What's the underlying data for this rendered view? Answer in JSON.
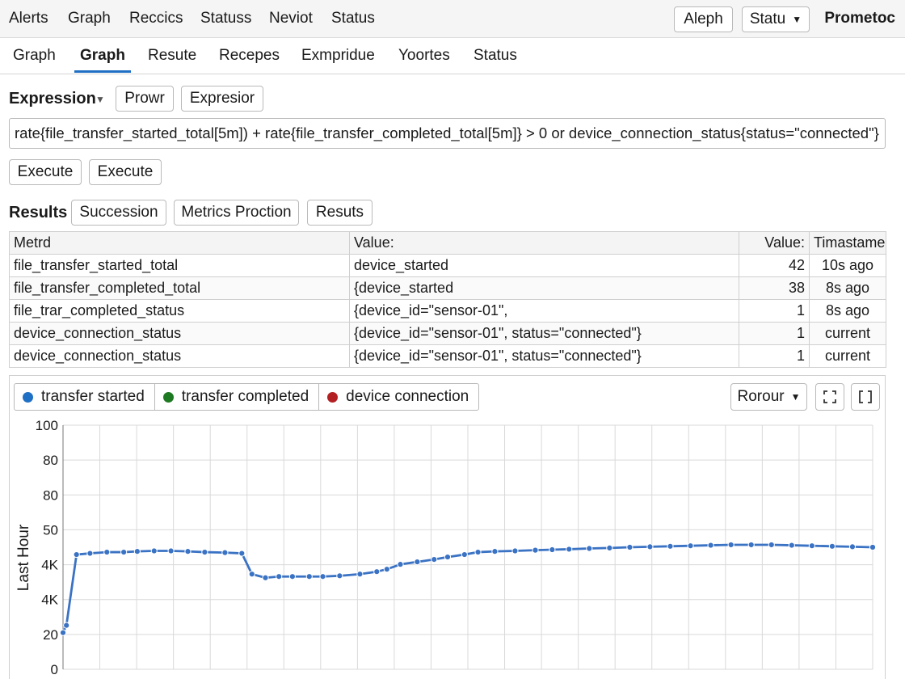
{
  "topnav": {
    "items": [
      "Alerts",
      "Graph",
      "Reccics",
      "Statuss",
      "Neviot",
      "Status"
    ],
    "aleph_button": "Aleph",
    "status_dropdown": "Statu",
    "brand": "Prometoc"
  },
  "tabs": [
    "Graph",
    "Graph",
    "Resute",
    "Recepes",
    "Exmpridue",
    "Yoortes",
    "Status"
  ],
  "expression": {
    "label": "Expression",
    "buttons": [
      "Prowr",
      "Expresior"
    ],
    "query": "rate{file_transfer_started_total[5m]) + rate{file_transfer_completed_total[5m]} > 0 or device_connection_status{status=\"connected\"}",
    "execute_buttons": [
      "Execute",
      "Execute"
    ]
  },
  "results": {
    "label": "Results",
    "buttons": [
      "Succession",
      "Metrics Proction",
      "Resuts"
    ],
    "columns": [
      "Metrd",
      "Value:",
      "Value:",
      "Timastame"
    ],
    "rows": [
      [
        "file_transfer_started_total",
        "device_started",
        "42",
        "10s ago"
      ],
      [
        "file_transfer_completed_total",
        "{device_started",
        "38",
        "8s ago"
      ],
      [
        "file_trar_completed_status",
        "{device_id=\"sensor-01\",",
        "1",
        "8s ago"
      ],
      [
        "device_connection_status",
        "{device_id=\"sensor-01\", status=\"connected\"}",
        "1",
        "current"
      ],
      [
        "device_connection_status",
        "{device_id=\"sensor-01\", status=\"connected\"}",
        "1",
        "current"
      ]
    ]
  },
  "graph": {
    "legend": [
      "transfer started",
      "transfer completed",
      "device connection"
    ],
    "range_dropdown": "Rorour",
    "ylabel": "Last Hour"
  },
  "colors": {
    "blue": "#3a72c4",
    "green": "#1e7a22",
    "red": "#b32023",
    "accent": "#1f6fc5"
  },
  "chart_data": {
    "type": "line",
    "title": "",
    "xlabel": "",
    "ylabel": "Last Hour",
    "ytick_labels": [
      "0",
      "20",
      "4K",
      "4K",
      "50",
      "80",
      "80",
      "100"
    ],
    "ylim": [
      0,
      100
    ],
    "grid": true,
    "legend_position": "top-left",
    "x": [
      0,
      1,
      4,
      8,
      13,
      18,
      22,
      27,
      32,
      37,
      42,
      48,
      53,
      56,
      60,
      64,
      68,
      73,
      77,
      82,
      88,
      93,
      96,
      100,
      105,
      110,
      114,
      119,
      123,
      128,
      134,
      140,
      145,
      150,
      156,
      162,
      168,
      174,
      180,
      186,
      192,
      198,
      204,
      210,
      216,
      222,
      228,
      234,
      240
    ],
    "series": [
      {
        "name": "transfer started",
        "color": "#3a72c4",
        "values": [
          15,
          18,
          47,
          47.5,
          48,
          48,
          48.3,
          48.5,
          48.5,
          48.3,
          48,
          47.8,
          47.5,
          39,
          37.5,
          38,
          38,
          38,
          38,
          38.3,
          39,
          40,
          41,
          43,
          44,
          45,
          46,
          47,
          48,
          48.3,
          48.5,
          48.8,
          49,
          49.2,
          49.5,
          49.7,
          50,
          50.2,
          50.4,
          50.6,
          50.8,
          51,
          51,
          51,
          50.8,
          50.6,
          50.4,
          50.2,
          50
        ]
      }
    ]
  }
}
